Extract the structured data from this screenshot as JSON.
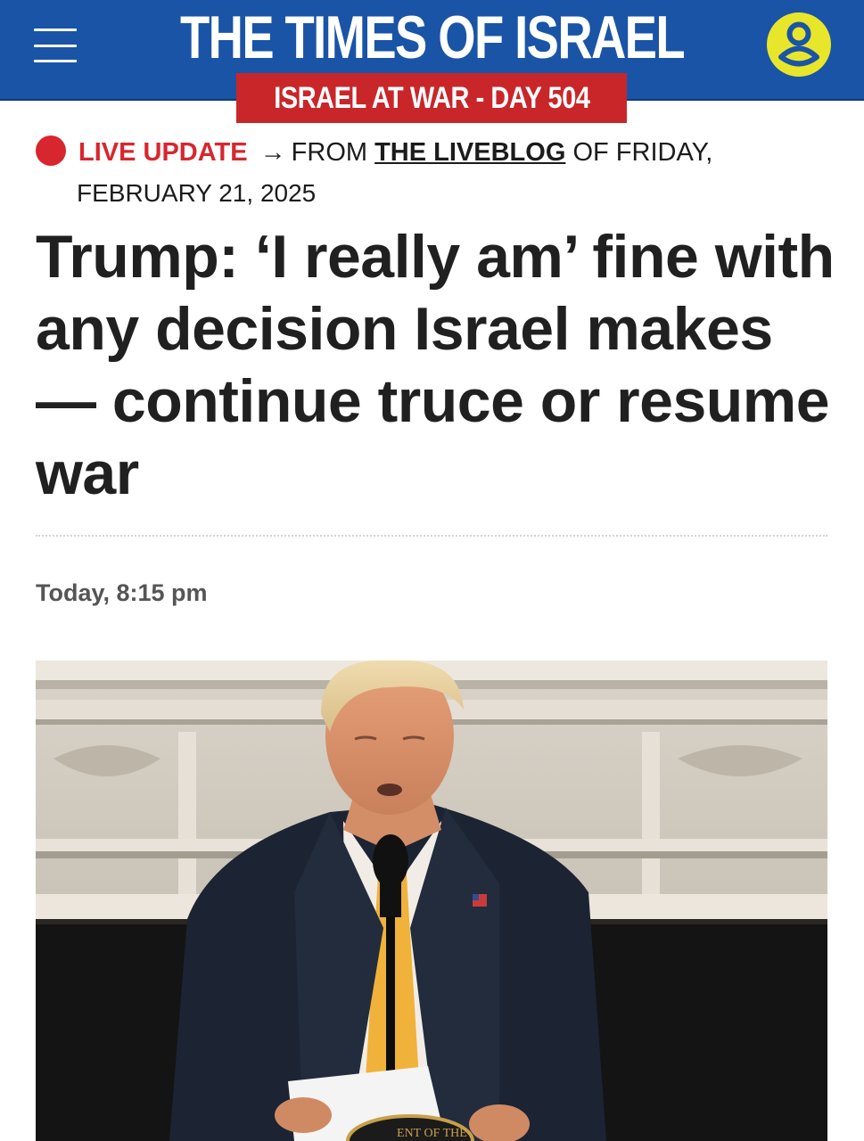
{
  "header": {
    "site_title": "THE TIMES OF ISRAEL",
    "war_badge": "ISRAEL AT WAR - DAY 504",
    "brand_color": "#1a54a6",
    "badge_color": "#c9262a",
    "account_color": "#e8e62a",
    "icons": [
      "hamburger-menu-icon",
      "account-icon"
    ]
  },
  "live": {
    "label": "LIVE UPDATE",
    "arrow": "→",
    "from": "FROM",
    "blog_link": "THE LIVEBLOG",
    "of_day": "OF FRIDAY,",
    "date": "FEBRUARY 21, 2025",
    "accent": "#d8262e"
  },
  "article": {
    "headline": "Trump: ‘I really am’ fine with any decision Israel makes — continue truce or resume war",
    "timestamp": "Today, 8:15 pm"
  },
  "photo": {
    "seal_text": "ENT OF THE"
  }
}
